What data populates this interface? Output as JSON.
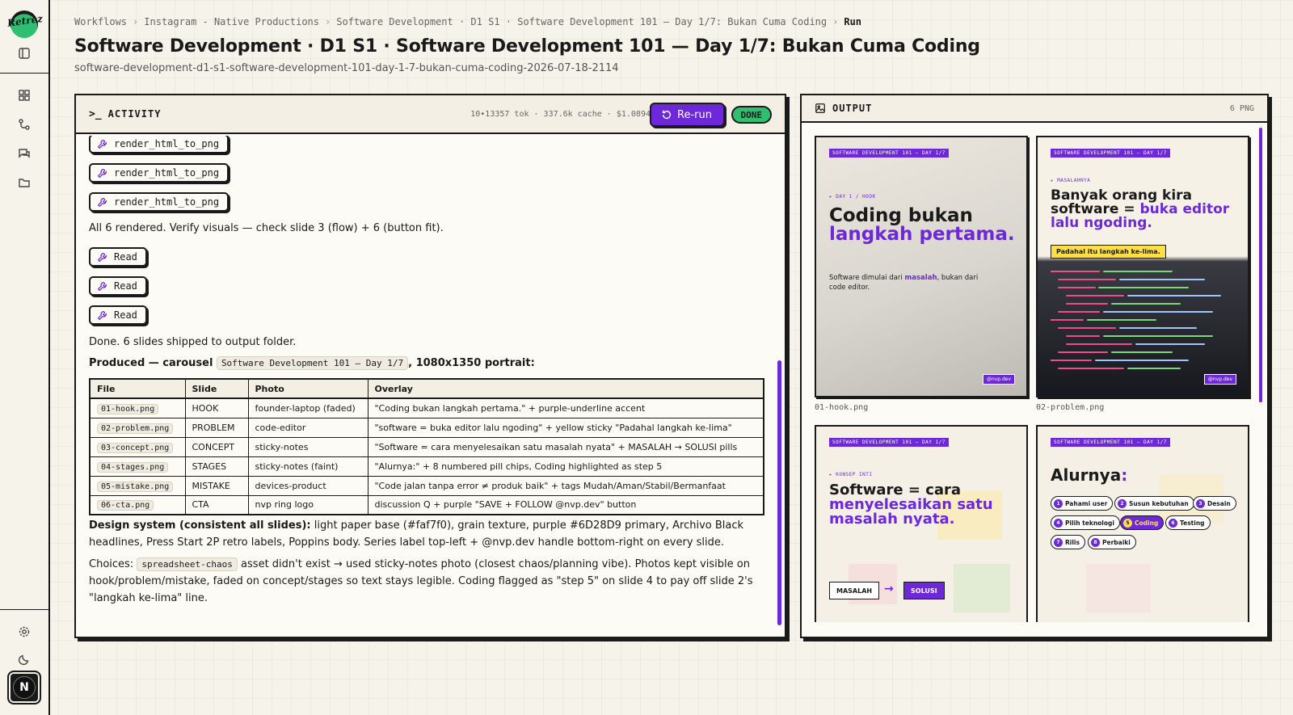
{
  "app": {
    "logo_text": "Retrez",
    "avatar_initial": "N"
  },
  "breadcrumbs": [
    "Workflows",
    "Instagram - Native Productions",
    "Software Development · D1 S1 · Software Development 101 — Day 1/7: Bukan Cuma Coding",
    "Run"
  ],
  "page": {
    "title": "Software Development · D1 S1 · Software Development 101 — Day 1/7: Bukan Cuma Coding",
    "slug": "software-development-d1-s1-software-development-101-day-1-7-bukan-cuma-coding-2026-07-18-2114"
  },
  "activity": {
    "title": "ACTIVITY",
    "stats": "10•13357 tok · 337.6k cache · $1.0894",
    "rerun_label": "Re-run",
    "status": "DONE",
    "tools_top": [
      "render_html_to_png",
      "render_html_to_png",
      "render_html_to_png"
    ],
    "msg_rendered": "All 6 rendered. Verify visuals — check slide 3 (flow) + 6 (button fit).",
    "tools_read": [
      "Read",
      "Read",
      "Read"
    ],
    "msg_done": "Done. 6 slides shipped to output folder.",
    "produced_prefix": "Produced — carousel",
    "produced_code": "Software Development 101 — Day 1/7",
    "produced_suffix": ", 1080x1350 portrait:",
    "table": {
      "headers": [
        "File",
        "Slide",
        "Photo",
        "Overlay"
      ],
      "rows": [
        [
          "01-hook.png",
          "HOOK",
          "founder-laptop (faded)",
          "\"Coding bukan langkah pertama.\" + purple-underline accent"
        ],
        [
          "02-problem.png",
          "PROBLEM",
          "code-editor",
          "\"software = buka editor lalu ngoding\" + yellow sticky \"Padahal langkah ke-lima\""
        ],
        [
          "03-concept.png",
          "CONCEPT",
          "sticky-notes",
          "\"Software = cara menyelesaikan satu masalah nyata\" + MASALAH → SOLUSI pills"
        ],
        [
          "04-stages.png",
          "STAGES",
          "sticky-notes (faint)",
          "\"Alurnya:\" + 8 numbered pill chips, Coding highlighted as step 5"
        ],
        [
          "05-mistake.png",
          "MISTAKE",
          "devices-product",
          "\"Code jalan tanpa error ≠ produk baik\" + tags Mudah/Aman/Stabil/Bermanfaat"
        ],
        [
          "06-cta.png",
          "CTA",
          "nvp ring logo",
          "discussion Q + purple \"SAVE + FOLLOW @nvp.dev\" button"
        ]
      ]
    },
    "design_label": "Design system (consistent all slides):",
    "design_text": " light paper base (#faf7f0), grain texture, purple #6D28D9 primary, Archivo Black headlines, Press Start 2P retro labels, Poppins body. Series label top-left + @nvp.dev handle bottom-right on every slide.",
    "choices_label": "Choices:",
    "choices_code": "spreadsheet-chaos",
    "choices_text": " asset didn't exist → used sticky-notes photo (closest chaos/planning vibe). Photos kept visible on hook/problem/mistake, faded on concept/stages so text stays legible. Coding flagged as \"step 5\" on slide 4 to pay off slide 2's \"langkah ke-lima\" line."
  },
  "output": {
    "title": "OUTPUT",
    "count": "6 PNG",
    "thumbs": [
      {
        "caption": "01-hook.png",
        "tag": "SOFTWARE DEVELOPMENT 101 — DAY 1/7",
        "kicker": "▸ DAY 1 / HOOK",
        "h1": "Coding bukan",
        "h2": "langkah pertama.",
        "body_a": "Software dimulai dari ",
        "body_b": "masalah",
        "body_c": ", bukan dari code editor.",
        "handle": "@nvp.dev"
      },
      {
        "caption": "02-problem.png",
        "tag": "SOFTWARE DEVELOPMENT 101 — DAY 1/7",
        "kicker": "▸ MASALAHNYA",
        "h1": "Banyak orang kira software = ",
        "h2": "buka editor lalu ngoding.",
        "sticky": "Padahal itu langkah ke-lima.",
        "handle": "@nvp.dev"
      },
      {
        "caption": "03-concept.png",
        "tag": "SOFTWARE DEVELOPMENT 101 — DAY 1/7",
        "kicker": "▸ KONSEP INTI",
        "h1": "Software = cara",
        "h2": "menyelesaikan satu masalah nyata.",
        "pill_a": "MASALAH",
        "pill_b": "SOLUSI"
      },
      {
        "caption": "04-stages.png",
        "tag": "SOFTWARE DEVELOPMENT 101 — DAY 1/7",
        "h1": "Alurnya",
        "h2": ":",
        "chips": [
          "Pahami user",
          "Susun kebutuhan",
          "Desain",
          "Pilih teknologi",
          "Coding",
          "Testing",
          "Rilis",
          "Perbaiki"
        ]
      }
    ]
  },
  "colors": {
    "accent": "#6d28d9",
    "done": "#2fbf71",
    "sticky": "#fde047"
  }
}
